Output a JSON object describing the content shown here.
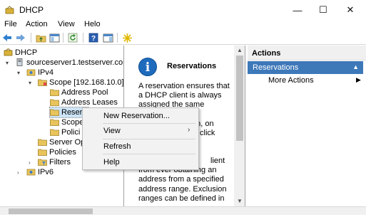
{
  "window": {
    "title": "DHCP",
    "minimize": "—",
    "maximize": "☐",
    "close": "✕"
  },
  "menu": {
    "file": "File",
    "action": "Action",
    "view": "View",
    "help": "Helo"
  },
  "tree": {
    "dhcp": "DHCP",
    "server": "sourceserver1.testserver.com",
    "ipv4": "IPv4",
    "scope": "Scope [192.168.10.0] T",
    "address_pool": "Address Pool",
    "address_leases": "Address Leases",
    "reservations": "Reserv",
    "scope_options": "Scope",
    "policies_sub": "Polici",
    "server_options": "Server Op",
    "policies": "Policies",
    "filters": "Filters",
    "ipv6": "IPv6"
  },
  "center": {
    "title": "Reservations",
    "text_1": "A reservation ensures that a DHCP client is always assigned the same",
    "text_2": "on, on",
    "text_3": "click",
    "text_4": "lient",
    "text_5": "from ever obtaining an address from a specified address range.  Exclusion ranges can be defined in"
  },
  "actions": {
    "header": "Actions",
    "section": "Reservations",
    "more_actions": "More Actions"
  },
  "context_menu": {
    "new_reservation": "New Reservation...",
    "view": "View",
    "refresh": "Refresh",
    "help": "Help"
  },
  "colors": {
    "accent": "#3d78b9",
    "info_icon": "#1e6bbd",
    "selection": "#cce4f7"
  }
}
